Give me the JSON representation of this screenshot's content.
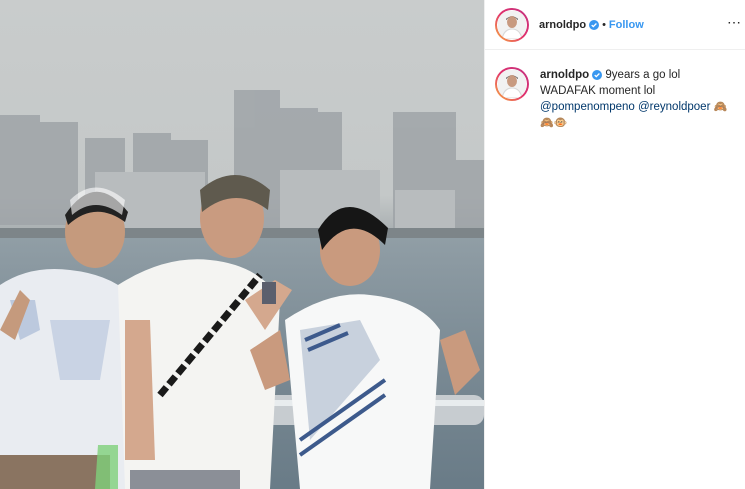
{
  "post": {
    "username": "arnoldpo",
    "separator": "•",
    "follow_label": "Follow",
    "more_label": "⋯"
  },
  "caption": {
    "username": "arnoldpo",
    "text": "9years a go lol WADAFAK moment lol",
    "mention_1": "@pompenompeno",
    "mention_2": "@reynoldpoer",
    "emojis": "🙈🙈🐵"
  },
  "icons": {
    "verified": "verified-badge-icon",
    "more": "more-options-icon"
  },
  "colors": {
    "follow_blue": "#3897f0",
    "verified_blue": "#3897f0",
    "mention": "#00376b",
    "ring_gradient": [
      "#f9b33f",
      "#e1306c",
      "#c13584"
    ]
  }
}
